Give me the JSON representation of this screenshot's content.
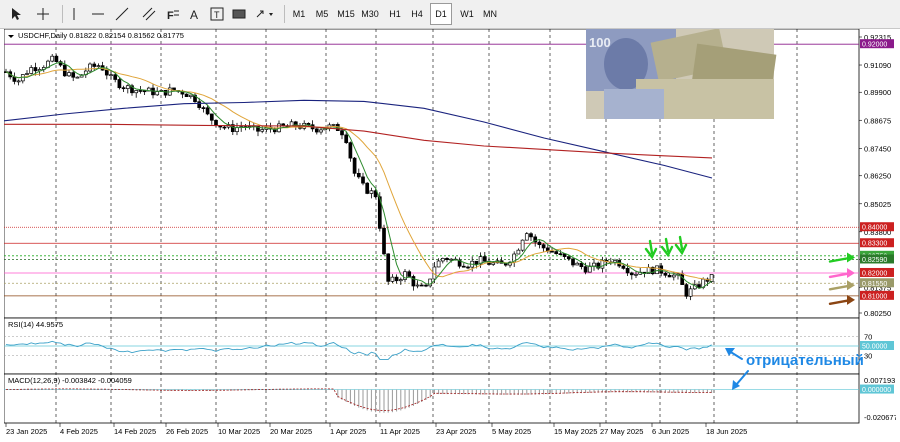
{
  "toolbar": {
    "timeframes": [
      "M1",
      "M5",
      "M15",
      "M30",
      "H1",
      "H4",
      "D1",
      "W1",
      "MN"
    ],
    "active_timeframe": "D1"
  },
  "chart_header": {
    "symbol": "USDCHF,Daily",
    "ohlc": "0.81822 0.82154 0.81562 0.81775"
  },
  "price_axis": {
    "labels": [
      "0.92315",
      "0.91090",
      "0.89900",
      "0.88675",
      "0.87450",
      "0.86250",
      "0.85025",
      "0.83800",
      "0.82600",
      "0.81375",
      "0.80250"
    ],
    "markers": [
      {
        "text": "0.92000",
        "bg": "#8b1a8b",
        "fg": "#ffffff"
      },
      {
        "text": "0.84000",
        "bg": "#cc2020",
        "fg": "#ffffff"
      },
      {
        "text": "0.83300",
        "bg": "#cc2020",
        "fg": "#ffffff"
      },
      {
        "text": "0.82750",
        "bg": "#3aa53a",
        "fg": "#ffffff"
      },
      {
        "text": "0.82590",
        "bg": "#2a7a2a",
        "fg": "#ffffff"
      },
      {
        "text": "0.82000",
        "bg": "#cc2020",
        "fg": "#ffffff"
      },
      {
        "text": "0.81550",
        "bg": "#9a9a6a",
        "fg": "#ffffff"
      },
      {
        "text": "0.81000",
        "bg": "#cc2020",
        "fg": "#ffffff"
      }
    ]
  },
  "rsi": {
    "label": "RSI(14) 44.9575",
    "scale": [
      "70",
      "50.0000",
      "30"
    ]
  },
  "macd": {
    "label": "MACD(12,26,9) -0.003842 -0.004059",
    "scale": [
      "0.007193",
      "0.000000",
      "-0.020677"
    ]
  },
  "date_axis": [
    "23 Jan 2025",
    "4 Feb 2025",
    "14 Feb 2025",
    "26 Feb 2025",
    "10 Mar 2025",
    "20 Mar 2025",
    "1 Apr 2025",
    "11 Apr 2025",
    "23 Apr 2025",
    "5 May 2025",
    "15 May 2025",
    "27 May 2025",
    "6 Jun 2025",
    "18 Jun 2025"
  ],
  "annotation": {
    "text": "отрицательный"
  },
  "colors": {
    "ma_fast": "#2e8b2e",
    "ma_mid": "#e0a53a",
    "ma_slow": "#1a237e",
    "ma_long": "#b22222",
    "rsi_line": "#3aa0c8",
    "macd_signal": "#a01818",
    "level_magenta": "#8b1a8b",
    "arrow_green": "#22cc22",
    "arrow_pink": "#ff66cc",
    "arrow_olive": "#aaa066",
    "arrow_brown": "#8b4513",
    "annotation_blue": "#1e88e5"
  }
}
